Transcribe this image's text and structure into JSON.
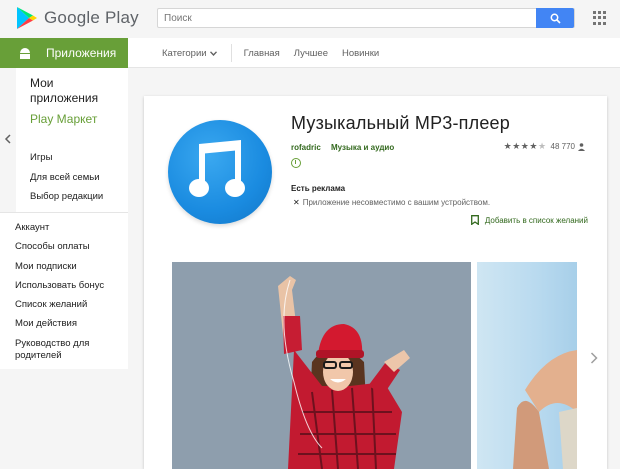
{
  "header": {
    "brand": "Google Play",
    "search_placeholder": "Поиск"
  },
  "subnav": {
    "apps_tab": "Приложения",
    "categories": "Категории",
    "items": [
      "Главная",
      "Лучшее",
      "Новинки"
    ]
  },
  "sidebar": {
    "my_apps": "Мои приложения",
    "play_market": "Play Маркет",
    "sub_items": [
      "Игры",
      "Для всей семьи",
      "Выбор редакции"
    ],
    "account_items": [
      "Аккаунт",
      "Способы оплаты",
      "Мои подписки",
      "Использовать бонус",
      "Список желаний",
      "Мои действия",
      "Руководство для родителей"
    ]
  },
  "app": {
    "title": "Музыкальный MP3-плеер",
    "developer": "rofadric",
    "genre": "Музыка и аудио",
    "rating_stars": 4.5,
    "ratings_count": "48 770",
    "ads_notice": "Есть реклама",
    "compat_notice": "Приложение несовместимо с вашим устройством.",
    "wishlist_label": "Добавить в список желаний"
  },
  "colors": {
    "accent_green": "#689f38",
    "dark_green": "#33691e",
    "search_blue": "#4285f4",
    "icon_blue": "#1a8be0"
  }
}
